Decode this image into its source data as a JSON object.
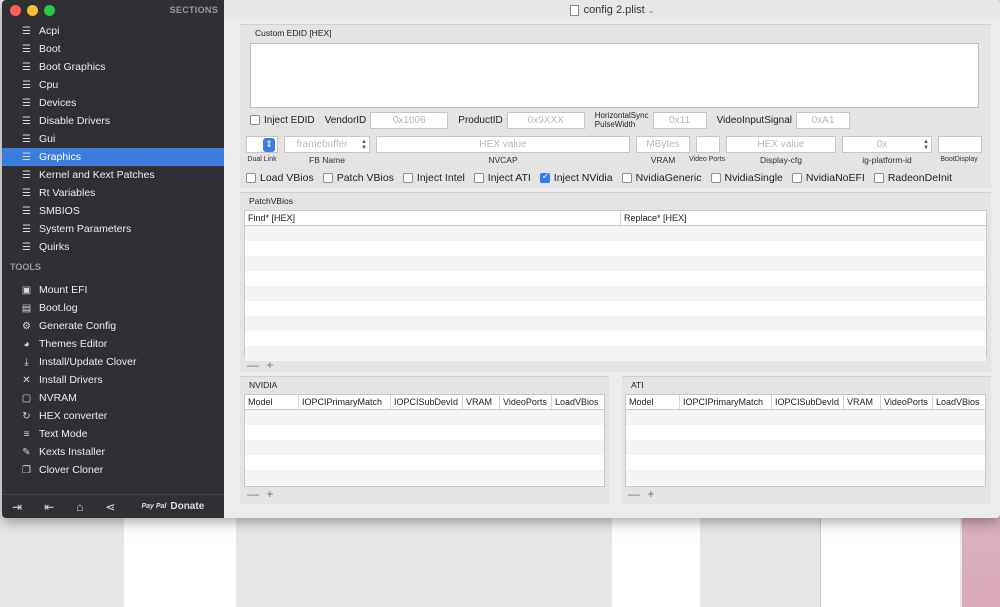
{
  "window": {
    "title": "config 2.plist"
  },
  "sidebar": {
    "header": "SECTIONS",
    "items": [
      {
        "label": "Acpi",
        "icon": "list-icon"
      },
      {
        "label": "Boot",
        "icon": "list-icon"
      },
      {
        "label": "Boot Graphics",
        "icon": "list-icon"
      },
      {
        "label": "Cpu",
        "icon": "list-icon"
      },
      {
        "label": "Devices",
        "icon": "list-icon"
      },
      {
        "label": "Disable Drivers",
        "icon": "list-icon"
      },
      {
        "label": "Gui",
        "icon": "list-icon"
      },
      {
        "label": "Graphics",
        "icon": "list-icon",
        "active": true
      },
      {
        "label": "Kernel and Kext Patches",
        "icon": "list-icon"
      },
      {
        "label": "Rt Variables",
        "icon": "list-icon"
      },
      {
        "label": "SMBIOS",
        "icon": "list-icon"
      },
      {
        "label": "System Parameters",
        "icon": "list-icon"
      },
      {
        "label": "Quirks",
        "icon": "list-icon"
      }
    ],
    "tools_header": "TOOLS",
    "tools": [
      {
        "label": "Mount EFI",
        "icon": "disk-icon"
      },
      {
        "label": "Boot.log",
        "icon": "log-icon"
      },
      {
        "label": "Generate Config",
        "icon": "gears-icon"
      },
      {
        "label": "Themes Editor",
        "icon": "palette-icon"
      },
      {
        "label": "Install/Update Clover",
        "icon": "download-icon"
      },
      {
        "label": "Install Drivers",
        "icon": "wrench-icon"
      },
      {
        "label": "NVRAM",
        "icon": "chip-icon"
      },
      {
        "label": "HEX converter",
        "icon": "refresh-icon"
      },
      {
        "label": "Text Mode",
        "icon": "text-icon"
      },
      {
        "label": "Kexts Installer",
        "icon": "puzzle-icon"
      },
      {
        "label": "Clover Cloner",
        "icon": "copy-icon"
      }
    ],
    "bottom": {
      "donate_label": "Donate",
      "paypal": "Pay Pal"
    }
  },
  "edid": {
    "legend": "Custom EDID [HEX]",
    "inject_label": "Inject EDID",
    "vendor_label": "VendorID",
    "vendor_placeholder": "0x1006",
    "product_label": "ProductID",
    "product_placeholder": "0x9XXX",
    "hsync_label_1": "HorizontalSync",
    "hsync_label_2": "PulseWidth",
    "hsync_placeholder": "0x11",
    "video_label": "VideoInputSignal",
    "video_placeholder": "0xA1"
  },
  "gfx": {
    "fb_placeholder": "framebuffer",
    "nvcap_placeholder": "HEX value",
    "vram_placeholder": "MBytes",
    "displaycfg_placeholder": "HEX value",
    "platform_placeholder": "0x",
    "dual_link": "Dual Link",
    "fb_name": "FB Name",
    "nvcap": "NVCAP",
    "vram": "VRAM",
    "video_ports": "Video Ports",
    "display_cfg": "Display-cfg",
    "platform_id": "ig-platform-id",
    "boot_display": "BootDisplay"
  },
  "checkboxes": [
    {
      "label": "Load VBios",
      "checked": false
    },
    {
      "label": "Patch VBios",
      "checked": false
    },
    {
      "label": "Inject Intel",
      "checked": false
    },
    {
      "label": "Inject ATI",
      "checked": false
    },
    {
      "label": "Inject NVidia",
      "checked": true
    },
    {
      "label": "NvidiaGeneric",
      "checked": false
    },
    {
      "label": "NvidiaSingle",
      "checked": false
    },
    {
      "label": "NvidiaNoEFI",
      "checked": false
    },
    {
      "label": "RadeonDeInit",
      "checked": false
    }
  ],
  "patchvbios": {
    "legend": "PatchVBios",
    "columns": [
      "Find* [HEX]",
      "Replace* [HEX]"
    ]
  },
  "nvidia": {
    "legend": "NVIDIA",
    "columns": [
      "Model",
      "IOPCIPrimaryMatch",
      "IOPCISubDevId",
      "VRAM",
      "VideoPorts",
      "LoadVBios"
    ]
  },
  "ati": {
    "legend": "ATI",
    "columns": [
      "Model",
      "IOPCIPrimaryMatch",
      "IOPCISubDevId",
      "VRAM",
      "VideoPorts",
      "LoadVBios"
    ]
  },
  "addremove": "— +"
}
